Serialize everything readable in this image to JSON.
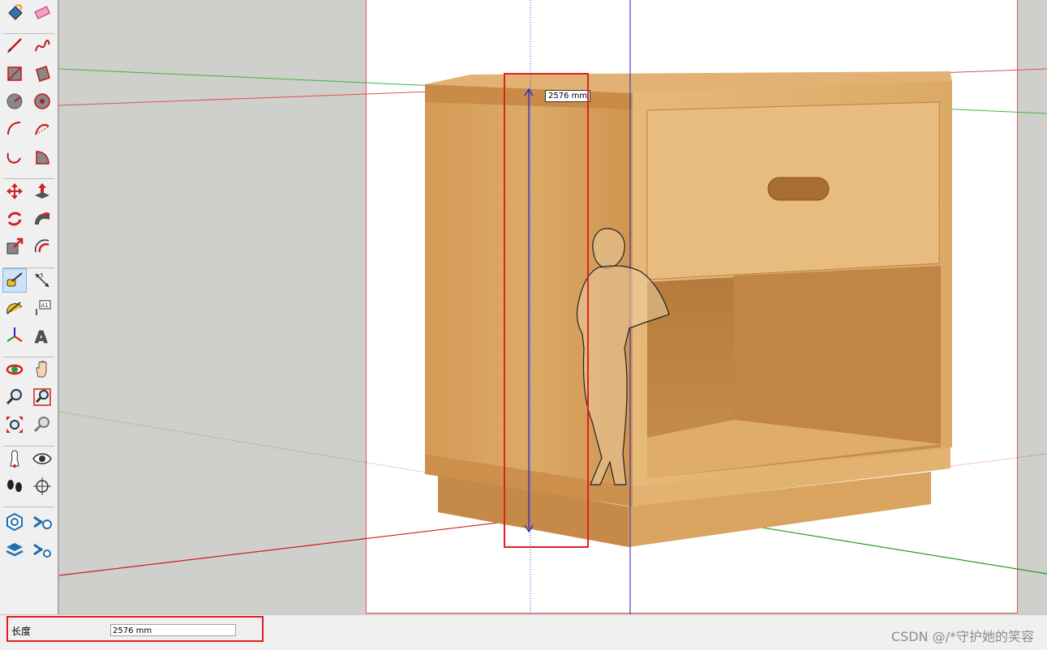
{
  "toolbar": {
    "tools": [
      {
        "name": "paint-bucket-icon"
      },
      {
        "name": "eraser-icon"
      },
      {
        "name": "line-icon"
      },
      {
        "name": "freehand-icon"
      },
      {
        "name": "rectangle-icon"
      },
      {
        "name": "rotated-rectangle-icon"
      },
      {
        "name": "circle-icon"
      },
      {
        "name": "polygon-icon"
      },
      {
        "name": "arc-icon"
      },
      {
        "name": "two-point-arc-icon"
      },
      {
        "name": "three-point-arc-icon"
      },
      {
        "name": "pie-icon"
      },
      {
        "name": "move-icon"
      },
      {
        "name": "push-pull-icon"
      },
      {
        "name": "rotate-icon"
      },
      {
        "name": "follow-me-icon"
      },
      {
        "name": "scale-icon"
      },
      {
        "name": "offset-icon"
      },
      {
        "name": "tape-measure-icon",
        "active": true
      },
      {
        "name": "dimension-icon"
      },
      {
        "name": "protractor-icon"
      },
      {
        "name": "text-icon",
        "label": "A1"
      },
      {
        "name": "axes-icon"
      },
      {
        "name": "3d-text-icon"
      },
      {
        "name": "orbit-icon"
      },
      {
        "name": "pan-icon"
      },
      {
        "name": "zoom-icon"
      },
      {
        "name": "zoom-window-icon"
      },
      {
        "name": "zoom-extents-icon"
      },
      {
        "name": "previous-view-icon"
      },
      {
        "name": "position-camera-icon"
      },
      {
        "name": "look-around-icon"
      },
      {
        "name": "walk-icon"
      },
      {
        "name": "section-plane-icon"
      },
      {
        "name": "warehouse-icon"
      },
      {
        "name": "share-model-icon"
      },
      {
        "name": "extension-warehouse-icon"
      },
      {
        "name": "extension-manager-icon"
      }
    ]
  },
  "viewport": {
    "dimension_label": "2576 mm"
  },
  "statusbar": {
    "measurement_label": "长度",
    "measurement_value": "2576 mm"
  },
  "watermark": "CSDN @/*守护她的笑容",
  "colors": {
    "x_axis": "#e0201e",
    "y_axis": "#1fa81f",
    "z_axis": "#1b1bd0",
    "highlight": "#e0201e",
    "wood": "#d9a868"
  }
}
